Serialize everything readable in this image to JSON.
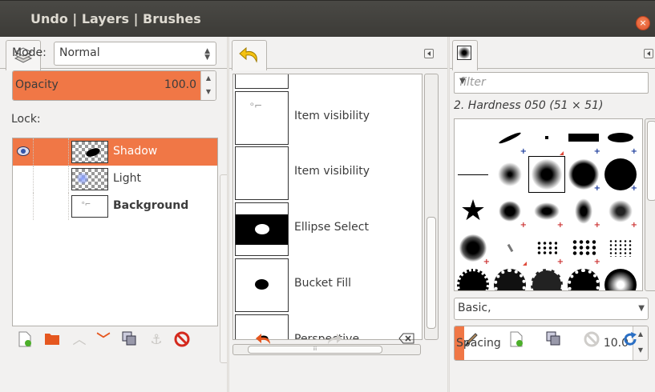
{
  "window": {
    "title": "Undo | Layers | Brushes",
    "close_glyph": "×"
  },
  "layers": {
    "mode_label": "Mode:",
    "mode_value": "Normal",
    "opacity_label": "Opacity",
    "opacity_value": "100.0",
    "opacity_fraction": 1.0,
    "lock_label": "Lock:",
    "items": [
      {
        "name": "Shadow",
        "selected": true,
        "visible": true,
        "bold": false
      },
      {
        "name": "Light",
        "selected": false,
        "visible": false,
        "bold": false
      },
      {
        "name": "Background",
        "selected": false,
        "visible": false,
        "bold": true
      }
    ],
    "bottom_icons": [
      "new-layer-icon",
      "new-layer-group-icon",
      "raise-layer-icon",
      "lower-layer-icon",
      "duplicate-layer-icon",
      "anchor-layer-icon",
      "delete-layer-icon"
    ]
  },
  "undo": {
    "items": [
      {
        "label": ""
      },
      {
        "label": "Item visibility"
      },
      {
        "label": "Item visibility"
      },
      {
        "label": "Ellipse Select"
      },
      {
        "label": "Bucket Fill"
      },
      {
        "label": "Perspective"
      }
    ],
    "hscroll_grip": "iii",
    "bottom_icons": [
      "undo-icon",
      "redo-icon",
      "clear-history-icon"
    ]
  },
  "brushes": {
    "filter_placeholder": "filter",
    "selected_brush": "2. Hardness 050 (51 × 51)",
    "preset_value": "Basic,",
    "spacing_label": "Spacing",
    "spacing_value": "10.0",
    "spacing_fraction": 0.05,
    "bottom_icons": [
      "edit-brush-icon",
      "new-brush-icon",
      "duplicate-brush-icon",
      "delete-brush-icon",
      "refresh-brushes-icon"
    ]
  },
  "colors": {
    "accent": "#f07746",
    "title_bg": "#3c3b37",
    "close": "#e0522b"
  }
}
